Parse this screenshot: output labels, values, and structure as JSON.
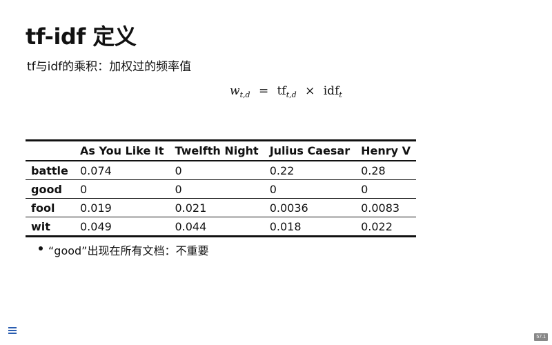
{
  "slide": {
    "title": "tf-idf 定义",
    "subtitle": "tf与idf的乘积：加权过的频率值",
    "formula": {
      "lhs_var": "w",
      "lhs_sub": "t,d",
      "equals": "=",
      "tf": "tf",
      "tf_sub": "t,d",
      "times": "×",
      "idf": "idf",
      "idf_sub": "t"
    },
    "table": {
      "columns": [
        "",
        "As You Like It",
        "Twelfth Night",
        "Julius Caesar",
        "Henry V"
      ],
      "rows": [
        {
          "term": "battle",
          "values": [
            "0.074",
            "0",
            "0.22",
            "0.28"
          ]
        },
        {
          "term": "good",
          "values": [
            "0",
            "0",
            "0",
            "0"
          ]
        },
        {
          "term": "fool",
          "values": [
            "0.019",
            "0.021",
            "0.0036",
            "0.0083"
          ]
        },
        {
          "term": "wit",
          "values": [
            "0.049",
            "0.044",
            "0.018",
            "0.022"
          ]
        }
      ]
    },
    "bullets": [
      "“good”出现在所有文档：不重要"
    ],
    "page_number": "57.1",
    "menu_icon": "menu-icon"
  }
}
